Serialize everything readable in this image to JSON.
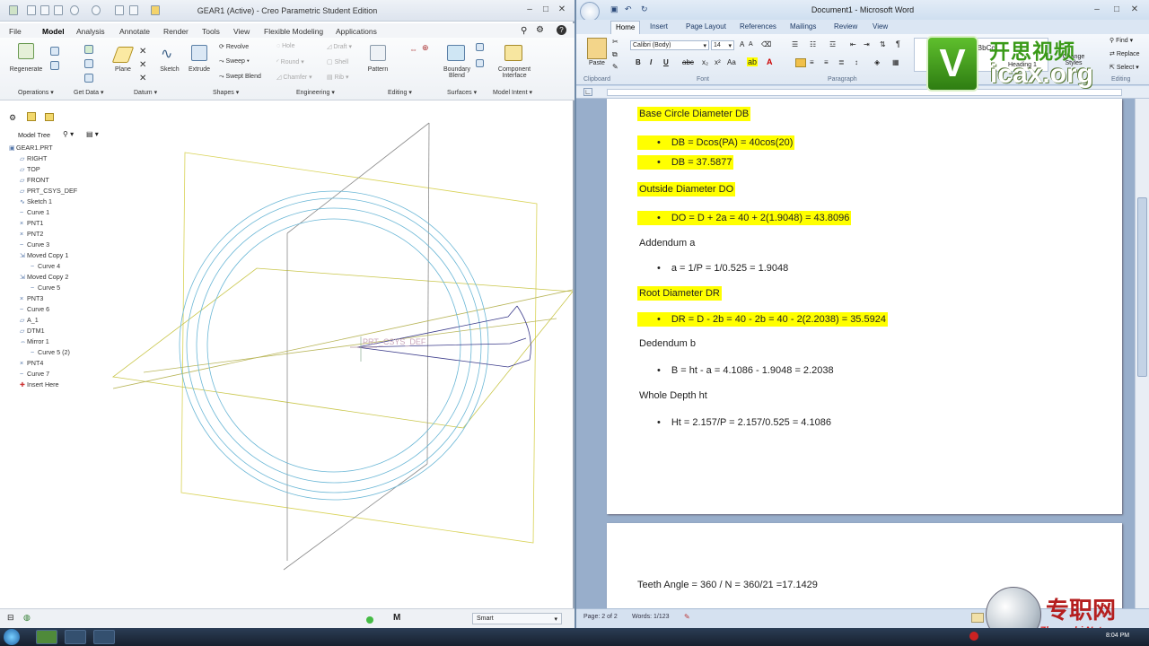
{
  "creo": {
    "title": "GEAR1 (Active) - Creo Parametric Student Edition",
    "tabs": [
      "File",
      "Model",
      "Analysis",
      "Annotate",
      "Render",
      "Tools",
      "View",
      "Flexible Modeling",
      "Applications"
    ],
    "ribbon": {
      "buttons": [
        "Regenerate",
        "Plane",
        "Sketch",
        "Extrude",
        "Revolve",
        "Sweep",
        "Swept Blend",
        "Hole",
        "Round",
        "Chamfer",
        "Draft",
        "Shell",
        "Rib",
        "Pattern",
        "Boundary Blend",
        "Component Interface"
      ],
      "groups": [
        "Operations",
        "Get Data",
        "Datum",
        "Shapes",
        "Engineering",
        "Editing",
        "Surfaces",
        "Model Intent"
      ]
    },
    "tree": {
      "header": "Model Tree",
      "items": [
        "GEAR1.PRT",
        "RIGHT",
        "TOP",
        "FRONT",
        "PRT_CSYS_DEF",
        "Sketch 1",
        "Curve 1",
        "PNT1",
        "PNT2",
        "Curve 3",
        "Moved Copy 1",
        "Curve 4",
        "Moved Copy 2",
        "Curve 5",
        "PNT3",
        "Curve 6",
        "A_1",
        "DTM1",
        "Mirror 1",
        "Curve 5 (2)",
        "PNT4",
        "Curve 7",
        "Insert Here"
      ]
    },
    "gfx_label": "PRT_CSYS_DEF",
    "status": {
      "filter": "Smart"
    }
  },
  "word": {
    "title": "Document1 - Microsoft Word",
    "tabs": [
      "Home",
      "Insert",
      "Page Layout",
      "References",
      "Mailings",
      "Review",
      "View"
    ],
    "font": "Calibri (Body)",
    "size": "14",
    "styles": [
      "AaBbCc",
      "Heading 1",
      "Change Styles"
    ],
    "editing": [
      "Find",
      "Replace",
      "Select"
    ],
    "group_labels": [
      "Clipboard",
      "Font",
      "Paragraph",
      "Editing"
    ],
    "paste": "Paste",
    "lines": [
      {
        "text": "Base Circle Diameter DB",
        "highlight": true,
        "bullet": false
      },
      {
        "text": "DB = Dcos(PA) = 40cos(20)",
        "highlight": true,
        "bullet": true
      },
      {
        "text": "DB = 37.5877",
        "highlight": true,
        "bullet": true
      },
      {
        "text": "Outside Diameter DO",
        "highlight": true,
        "bullet": false
      },
      {
        "text": "DO = D + 2a = 40 + 2(1.9048) = 43.8096",
        "highlight": true,
        "bullet": true
      },
      {
        "text": "Addendum a",
        "highlight": false,
        "bullet": false
      },
      {
        "text": "a = 1/P = 1/0.525 = 1.9048",
        "highlight": false,
        "bullet": true
      },
      {
        "text": "Root Diameter DR",
        "highlight": true,
        "bullet": false
      },
      {
        "text": "DR = D - 2b = 40 - 2b = 40 - 2(2.2038) = 35.5924",
        "highlight": true,
        "bullet": true
      },
      {
        "text": "Dedendum b",
        "highlight": false,
        "bullet": false
      },
      {
        "text": "B = ht - a = 4.1086 - 1.9048 = 2.2038",
        "highlight": false,
        "bullet": true
      },
      {
        "text": "Whole Depth ht",
        "highlight": false,
        "bullet": false
      },
      {
        "text": "Ht = 2.157/P = 2.157/0.525 = 4.1086",
        "highlight": false,
        "bullet": true
      }
    ],
    "page2_line": "Teeth Angle = 360 / N = 360/21 =17.1429",
    "status": {
      "page": "Page: 2 of 2",
      "words": "Words: 1/123"
    }
  },
  "watermarks": {
    "top_cn": "开思视频",
    "top_en": "icax.org",
    "bottom_cn": "专职网",
    "bottom_en": "Zhuanzhi.Net"
  },
  "taskbar": {
    "time": "8:04 PM"
  }
}
